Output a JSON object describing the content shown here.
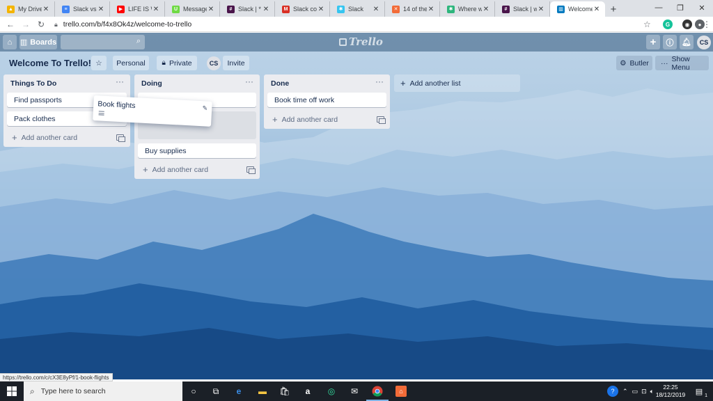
{
  "browser": {
    "tabs": [
      {
        "title": "My Drive",
        "icon": "google-drive-icon",
        "color": "#f4b400"
      },
      {
        "title": "Slack vs Tr",
        "icon": "google-docs-icon",
        "color": "#4285f4"
      },
      {
        "title": "LIFE IS WE",
        "icon": "youtube-icon",
        "color": "#ff0000"
      },
      {
        "title": "Messages",
        "icon": "upwork-icon",
        "color": "#6fda44"
      },
      {
        "title": "Slack | * w",
        "icon": "slack-icon",
        "color": "#4a154b"
      },
      {
        "title": "Slack conf",
        "icon": "gmail-icon",
        "color": "#d93025"
      },
      {
        "title": "Slack",
        "icon": "slack-logo-icon",
        "color": "#36c5f0"
      },
      {
        "title": "14 of the",
        "icon": "orange-site-icon",
        "color": "#f26b38"
      },
      {
        "title": "Where wo",
        "icon": "slack-logo-icon",
        "color": "#2eb67d"
      },
      {
        "title": "Slack | wel",
        "icon": "slack-icon",
        "color": "#4a154b"
      },
      {
        "title": "Welcome",
        "icon": "trello-icon",
        "color": "#0079bf",
        "active": true
      }
    ],
    "url": "trello.com/b/f4x8Ok4z/welcome-to-trello",
    "status_url": "https://trello.com/c/cX3E8yPf/1-book-flights"
  },
  "header": {
    "boards_label": "Boards",
    "logo_text": "Trello",
    "avatar_initials": "CS"
  },
  "board": {
    "title": "Welcome To Trello!",
    "personal_label": "Personal",
    "private_label": "Private",
    "member_initials": "CS",
    "invite_label": "Invite",
    "butler_label": "Butler",
    "show_menu_label": "Show Menu",
    "add_list_label": "Add another list",
    "add_card_label": "Add another card"
  },
  "lists": [
    {
      "title": "Things To Do",
      "cards": [
        "Find passports",
        "Pack clothes"
      ]
    },
    {
      "title": "Doing",
      "cards": [
        "Buy supplies"
      ]
    },
    {
      "title": "Done",
      "cards": [
        "Book time off work"
      ]
    }
  ],
  "dragging_card": {
    "title": "Book flights"
  },
  "taskbar": {
    "search_placeholder": "Type here to search",
    "time": "22:25",
    "date": "18/12/2019",
    "notifications": "1"
  }
}
